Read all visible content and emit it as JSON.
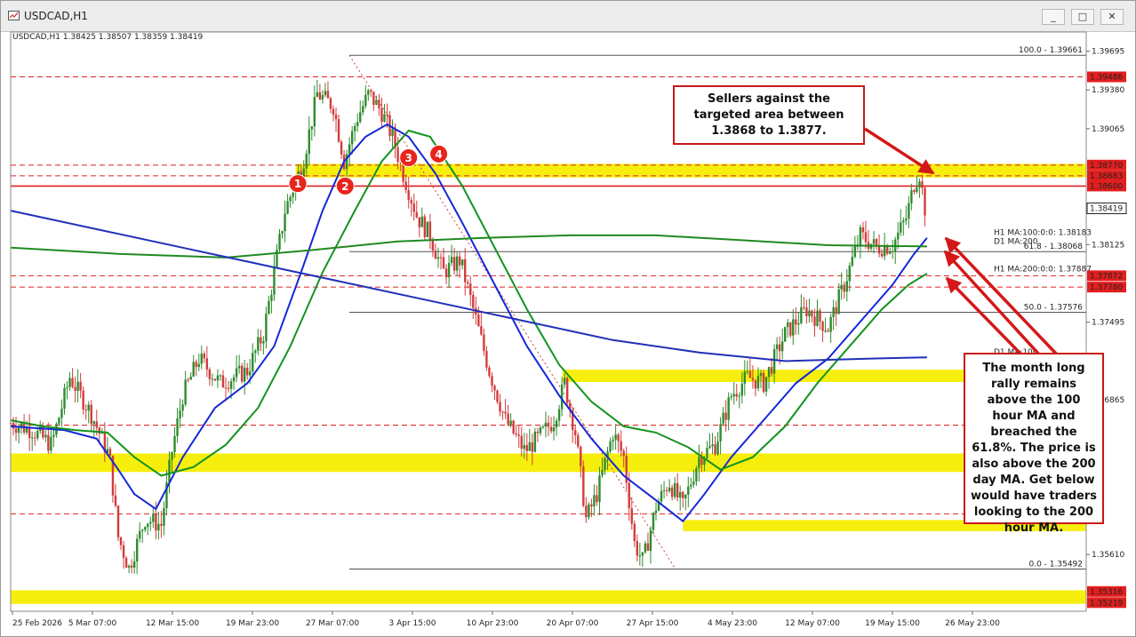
{
  "window": {
    "title": "USDCAD,H1",
    "buttons": [
      "_",
      "□",
      "✕"
    ]
  },
  "header_text": "USDCAD,H1  1.38425 1.38507 1.38359 1.38419",
  "colors": {
    "ma100_hour": "#1428d8",
    "ma200_hour": "#12931e",
    "ma100_day": "#2030b8",
    "ma200_day": "#208a20",
    "zone": "#f5ee00",
    "level_line": "#e02020",
    "fib_line": "#555555",
    "bull_candle": "#2e8b2e",
    "bear_candle": "#d23c3c",
    "annotation_border": "#c91818"
  },
  "chart_data": {
    "type": "candlestick",
    "symbol": "USDCAD",
    "timeframe": "H1",
    "ohlc_last": {
      "open": 1.38425,
      "high": 1.38507,
      "low": 1.38359,
      "close": 1.38419
    },
    "ylim": [
      1.3515,
      1.3985
    ],
    "x_ticks": [
      "25 Feb 2026",
      "5 Mar 07:00",
      "12 Mar 15:00",
      "19 Mar 23:00",
      "27 Mar 07:00",
      "3 Apr 15:00",
      "10 Apr 23:00",
      "20 Apr 07:00",
      "27 Apr 15:00",
      "4 May 23:00",
      "12 May 07:00",
      "19 May 15:00",
      "26 May 23:00"
    ],
    "y_ticks": [
      {
        "v": 1.39695,
        "label": "1.39695"
      },
      {
        "v": 1.3938,
        "label": "1.39380"
      },
      {
        "v": 1.39065,
        "label": "1.39065"
      },
      {
        "v": 1.38125,
        "label": "1.38125"
      },
      {
        "v": 1.37495,
        "label": "1.37495"
      },
      {
        "v": 1.36865,
        "label": "1.36865"
      },
      {
        "v": 1.3561,
        "label": "1.35610"
      }
    ],
    "price_labels": [
      {
        "v": 1.39486,
        "label": "1.39486",
        "style": "red"
      },
      {
        "v": 1.3877,
        "label": "1.38770",
        "style": "red"
      },
      {
        "v": 1.38683,
        "label": "1.38683",
        "style": "red"
      },
      {
        "v": 1.386,
        "label": "1.38600",
        "style": "red"
      },
      {
        "v": 1.38419,
        "label": "1.38419",
        "style": "current"
      },
      {
        "v": 1.37872,
        "label": "1.37872",
        "style": "red"
      },
      {
        "v": 1.3778,
        "label": "1.37780",
        "style": "red"
      },
      {
        "v": 1.3531,
        "label": "1.35316",
        "style": "red"
      },
      {
        "v": 1.3522,
        "label": "1.35219",
        "style": "red"
      }
    ],
    "fibonacci": [
      {
        "v": 1.39661,
        "label": "100.0 - 1.39661"
      },
      {
        "v": 1.38068,
        "label": "61.8 - 1.38068"
      },
      {
        "v": 1.37576,
        "label": "50.0 - 1.37576"
      },
      {
        "v": 1.35492,
        "label": "0.0 - 1.35492"
      }
    ],
    "fib_swing": {
      "high_date": "27 Mar",
      "low_date": "4 May"
    },
    "ma_labels": [
      {
        "v": 1.38183,
        "label": "H1 MA:100:0:0: 1.38183",
        "color": "#1428d8"
      },
      {
        "v": 1.3811,
        "label": "D1 MA:200",
        "color": "#12931e"
      },
      {
        "v": 1.37887,
        "label": "H1 MA:200:0:0: 1.37887",
        "color": "#12931e"
      },
      {
        "v": 1.3721,
        "label": "D1 MA:100",
        "color": "#2030b8"
      }
    ],
    "zones": [
      {
        "from": 1.3867,
        "to": 1.3878,
        "start": 0.265
      },
      {
        "from": 1.3701,
        "to": 1.3711,
        "start": 0.513
      },
      {
        "from": 1.3628,
        "to": 1.3643,
        "start": 0.0
      },
      {
        "from": 1.358,
        "to": 1.3589,
        "start": 0.625
      },
      {
        "from": 1.3521,
        "to": 1.3532,
        "start": 0.0
      }
    ],
    "red_levels": [
      {
        "v": 1.386,
        "start": 0.0,
        "style": "solid"
      },
      {
        "v": 1.39486,
        "start": 0.0,
        "style": "dash"
      },
      {
        "v": 1.3877,
        "start": 0.0,
        "style": "dash"
      },
      {
        "v": 1.38683,
        "start": 0.0,
        "style": "dash"
      },
      {
        "v": 1.37872,
        "start": 0.0,
        "style": "dash"
      },
      {
        "v": 1.3778,
        "start": 0.0,
        "style": "dash"
      },
      {
        "v": 1.3666,
        "start": 0.0,
        "style": "dash"
      },
      {
        "v": 1.3594,
        "start": 0.0,
        "style": "dash"
      }
    ],
    "markers": [
      {
        "label": "1",
        "t": 0.267,
        "v": 1.3862
      },
      {
        "label": "2",
        "t": 0.311,
        "v": 1.386
      },
      {
        "label": "3",
        "t": 0.37,
        "v": 1.3883
      },
      {
        "label": "4",
        "t": 0.398,
        "v": 1.3886
      }
    ],
    "price_path": [
      [
        0.0,
        1.3668
      ],
      [
        0.02,
        1.3662
      ],
      [
        0.038,
        1.365
      ],
      [
        0.055,
        1.3705
      ],
      [
        0.075,
        1.3675
      ],
      [
        0.092,
        1.364
      ],
      [
        0.1,
        1.3575
      ],
      [
        0.11,
        1.355
      ],
      [
        0.125,
        1.359
      ],
      [
        0.14,
        1.3585
      ],
      [
        0.15,
        1.3645
      ],
      [
        0.16,
        1.369
      ],
      [
        0.175,
        1.372
      ],
      [
        0.195,
        1.37
      ],
      [
        0.22,
        1.371
      ],
      [
        0.235,
        1.374
      ],
      [
        0.255,
        1.384
      ],
      [
        0.272,
        1.388
      ],
      [
        0.285,
        1.3935
      ],
      [
        0.3,
        1.3925
      ],
      [
        0.31,
        1.388
      ],
      [
        0.322,
        1.3915
      ],
      [
        0.333,
        1.3935
      ],
      [
        0.345,
        1.392
      ],
      [
        0.355,
        1.39
      ],
      [
        0.365,
        1.387
      ],
      [
        0.378,
        1.3835
      ],
      [
        0.39,
        1.382
      ],
      [
        0.402,
        1.379
      ],
      [
        0.418,
        1.38
      ],
      [
        0.43,
        1.376
      ],
      [
        0.445,
        1.371
      ],
      [
        0.46,
        1.367
      ],
      [
        0.478,
        1.3645
      ],
      [
        0.49,
        1.3655
      ],
      [
        0.505,
        1.367
      ],
      [
        0.515,
        1.37
      ],
      [
        0.525,
        1.366
      ],
      [
        0.535,
        1.359
      ],
      [
        0.545,
        1.361
      ],
      [
        0.56,
        1.366
      ],
      [
        0.57,
        1.364
      ],
      [
        0.58,
        1.357
      ],
      [
        0.588,
        1.3555
      ],
      [
        0.6,
        1.36
      ],
      [
        0.612,
        1.362
      ],
      [
        0.625,
        1.36
      ],
      [
        0.64,
        1.364
      ],
      [
        0.655,
        1.365
      ],
      [
        0.67,
        1.369
      ],
      [
        0.685,
        1.3705
      ],
      [
        0.7,
        1.37
      ],
      [
        0.72,
        1.374
      ],
      [
        0.74,
        1.376
      ],
      [
        0.76,
        1.3745
      ],
      [
        0.775,
        1.378
      ],
      [
        0.79,
        1.382
      ],
      [
        0.805,
        1.381
      ],
      [
        0.82,
        1.3812
      ],
      [
        0.833,
        1.3835
      ],
      [
        0.84,
        1.3862
      ],
      [
        0.845,
        1.387
      ],
      [
        0.85,
        1.3842
      ]
    ],
    "series": [
      {
        "name": "H1 MA:100",
        "color": "#1428d8",
        "points": [
          [
            0.0,
            1.3665
          ],
          [
            0.05,
            1.3662
          ],
          [
            0.08,
            1.3655
          ],
          [
            0.1,
            1.363
          ],
          [
            0.115,
            1.361
          ],
          [
            0.135,
            1.3598
          ],
          [
            0.16,
            1.364
          ],
          [
            0.19,
            1.368
          ],
          [
            0.22,
            1.37
          ],
          [
            0.245,
            1.373
          ],
          [
            0.27,
            1.379
          ],
          [
            0.29,
            1.384
          ],
          [
            0.31,
            1.388
          ],
          [
            0.33,
            1.39
          ],
          [
            0.35,
            1.391
          ],
          [
            0.37,
            1.39
          ],
          [
            0.395,
            1.387
          ],
          [
            0.42,
            1.383
          ],
          [
            0.45,
            1.378
          ],
          [
            0.48,
            1.373
          ],
          [
            0.51,
            1.369
          ],
          [
            0.54,
            1.3655
          ],
          [
            0.57,
            1.3625
          ],
          [
            0.6,
            1.3605
          ],
          [
            0.625,
            1.3588
          ],
          [
            0.645,
            1.361
          ],
          [
            0.67,
            1.364
          ],
          [
            0.7,
            1.367
          ],
          [
            0.73,
            1.37
          ],
          [
            0.76,
            1.372
          ],
          [
            0.79,
            1.375
          ],
          [
            0.82,
            1.378
          ],
          [
            0.84,
            1.3805
          ],
          [
            0.852,
            1.3818
          ]
        ]
      },
      {
        "name": "H1 MA:200",
        "color": "#12931e",
        "points": [
          [
            0.0,
            1.367
          ],
          [
            0.03,
            1.3665
          ],
          [
            0.06,
            1.3662
          ],
          [
            0.09,
            1.366
          ],
          [
            0.115,
            1.364
          ],
          [
            0.14,
            1.3625
          ],
          [
            0.17,
            1.3632
          ],
          [
            0.2,
            1.365
          ],
          [
            0.23,
            1.368
          ],
          [
            0.26,
            1.373
          ],
          [
            0.29,
            1.379
          ],
          [
            0.32,
            1.384
          ],
          [
            0.345,
            1.388
          ],
          [
            0.37,
            1.3905
          ],
          [
            0.39,
            1.39
          ],
          [
            0.42,
            1.386
          ],
          [
            0.45,
            1.381
          ],
          [
            0.48,
            1.376
          ],
          [
            0.51,
            1.3715
          ],
          [
            0.54,
            1.3685
          ],
          [
            0.57,
            1.3665
          ],
          [
            0.6,
            1.366
          ],
          [
            0.63,
            1.3648
          ],
          [
            0.66,
            1.363
          ],
          [
            0.69,
            1.364
          ],
          [
            0.72,
            1.3665
          ],
          [
            0.75,
            1.37
          ],
          [
            0.78,
            1.373
          ],
          [
            0.81,
            1.376
          ],
          [
            0.835,
            1.378
          ],
          [
            0.852,
            1.3789
          ]
        ]
      },
      {
        "name": "D1 MA:200",
        "color": "#208a20",
        "points": [
          [
            0.0,
            1.381
          ],
          [
            0.1,
            1.3805
          ],
          [
            0.2,
            1.3802
          ],
          [
            0.28,
            1.3808
          ],
          [
            0.36,
            1.3815
          ],
          [
            0.44,
            1.3818
          ],
          [
            0.52,
            1.382
          ],
          [
            0.6,
            1.382
          ],
          [
            0.68,
            1.3816
          ],
          [
            0.76,
            1.3812
          ],
          [
            0.852,
            1.3811
          ]
        ]
      },
      {
        "name": "D1 MA:100",
        "color": "#2030b8",
        "points": [
          [
            0.0,
            1.384
          ],
          [
            0.08,
            1.3825
          ],
          [
            0.16,
            1.381
          ],
          [
            0.24,
            1.3795
          ],
          [
            0.32,
            1.378
          ],
          [
            0.4,
            1.3765
          ],
          [
            0.48,
            1.375
          ],
          [
            0.56,
            1.3735
          ],
          [
            0.64,
            1.3725
          ],
          [
            0.72,
            1.3718
          ],
          [
            0.8,
            1.372
          ],
          [
            0.852,
            1.3721
          ]
        ]
      }
    ]
  },
  "annotations": {
    "top": "Sellers against the targeted area between 1.3868 to 1.3877.",
    "bottom": "The month long rally remains above the 100 hour MA and breached the 61.8%. The price is also above the 200 day MA.  Get below would have traders looking to the 200 hour MA."
  }
}
